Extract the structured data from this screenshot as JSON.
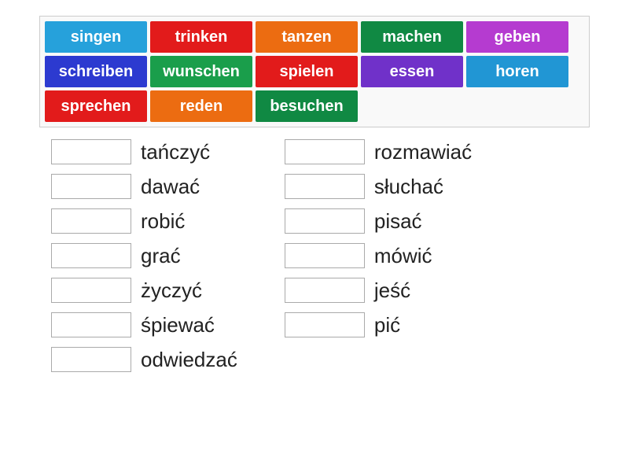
{
  "word_bank": [
    {
      "label": "singen",
      "color": "c-blue1"
    },
    {
      "label": "trinken",
      "color": "c-red"
    },
    {
      "label": "tanzen",
      "color": "c-orange"
    },
    {
      "label": "machen",
      "color": "c-green1"
    },
    {
      "label": "geben",
      "color": "c-purple1"
    },
    {
      "label": "schreiben",
      "color": "c-blue2"
    },
    {
      "label": "wunschen",
      "color": "c-green2"
    },
    {
      "label": "spielen",
      "color": "c-red2"
    },
    {
      "label": "essen",
      "color": "c-purple2"
    },
    {
      "label": "horen",
      "color": "c-blue3"
    },
    {
      "label": "sprechen",
      "color": "c-red3"
    },
    {
      "label": "reden",
      "color": "c-orange2"
    },
    {
      "label": "besuchen",
      "color": "c-green3"
    }
  ],
  "answers_left": [
    "tańczyć",
    "dawać",
    "robić",
    "grać",
    "życzyć",
    "śpiewać",
    "odwiedzać"
  ],
  "answers_right": [
    "rozmawiać",
    "słuchać",
    "pisać",
    "mówić",
    "jeść",
    "pić"
  ]
}
